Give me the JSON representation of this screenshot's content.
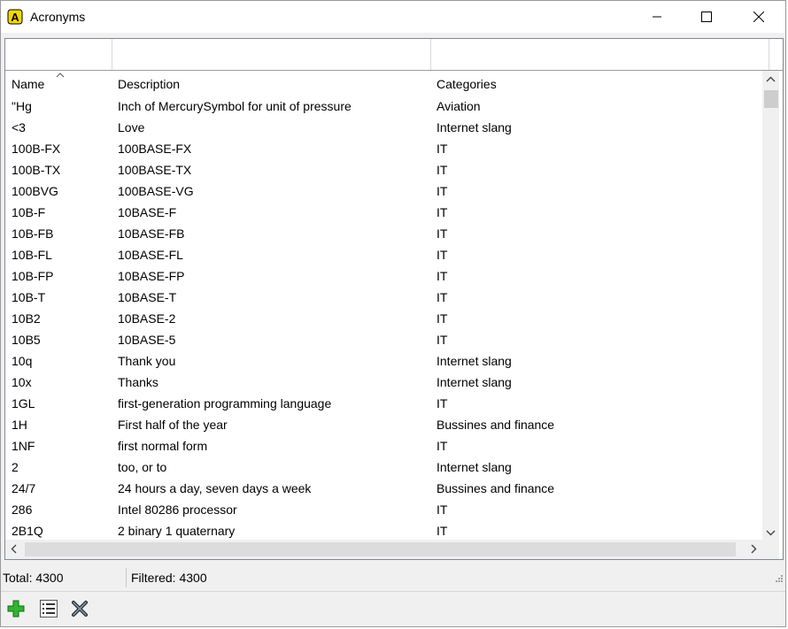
{
  "window": {
    "title": "Acronyms"
  },
  "filters": {
    "name": "",
    "description": "",
    "categories": ""
  },
  "columns": {
    "name": "Name",
    "description": "Description",
    "categories": "Categories"
  },
  "rows": [
    {
      "name": "\"Hg",
      "description": "Inch of MercurySymbol for unit of pressure",
      "category": "Aviation"
    },
    {
      "name": "<3",
      "description": "Love",
      "category": "Internet slang"
    },
    {
      "name": "100B-FX",
      "description": "100BASE-FX",
      "category": "IT"
    },
    {
      "name": "100B-TX",
      "description": "100BASE-TX",
      "category": "IT"
    },
    {
      "name": "100BVG",
      "description": "100BASE-VG",
      "category": "IT"
    },
    {
      "name": "10B-F",
      "description": "10BASE-F",
      "category": "IT"
    },
    {
      "name": "10B-FB",
      "description": "10BASE-FB",
      "category": "IT"
    },
    {
      "name": "10B-FL",
      "description": "10BASE-FL",
      "category": "IT"
    },
    {
      "name": "10B-FP",
      "description": "10BASE-FP",
      "category": "IT"
    },
    {
      "name": "10B-T",
      "description": "10BASE-T",
      "category": "IT"
    },
    {
      "name": "10B2",
      "description": "10BASE-2",
      "category": "IT"
    },
    {
      "name": "10B5",
      "description": "10BASE-5",
      "category": "IT"
    },
    {
      "name": "10q",
      "description": "Thank you",
      "category": "Internet slang"
    },
    {
      "name": "10x",
      "description": "Thanks",
      "category": "Internet slang"
    },
    {
      "name": "1GL",
      "description": "first-generation programming language",
      "category": "IT"
    },
    {
      "name": "1H",
      "description": "First half of the year",
      "category": "Bussines and finance"
    },
    {
      "name": "1NF",
      "description": "first normal form",
      "category": "IT"
    },
    {
      "name": "2",
      "description": "too, or to",
      "category": "Internet slang"
    },
    {
      "name": "24/7",
      "description": "24 hours a day, seven days a week",
      "category": "Bussines and finance"
    },
    {
      "name": "286",
      "description": "Intel 80286 processor",
      "category": "IT"
    },
    {
      "name": "2B1Q",
      "description": "2 binary 1 quaternary",
      "category": "IT"
    }
  ],
  "status": {
    "total": "Total: 4300",
    "filtered": "Filtered: 4300"
  },
  "icons": {
    "app": "acronyms-app-icon",
    "add": "add-icon",
    "list": "list-icon",
    "delete": "delete-icon",
    "sort": "sort-ascending-icon"
  },
  "colors": {
    "add_green": "#2fb52f",
    "app_icon_yellow": "#f5d800",
    "border": "#828790"
  }
}
